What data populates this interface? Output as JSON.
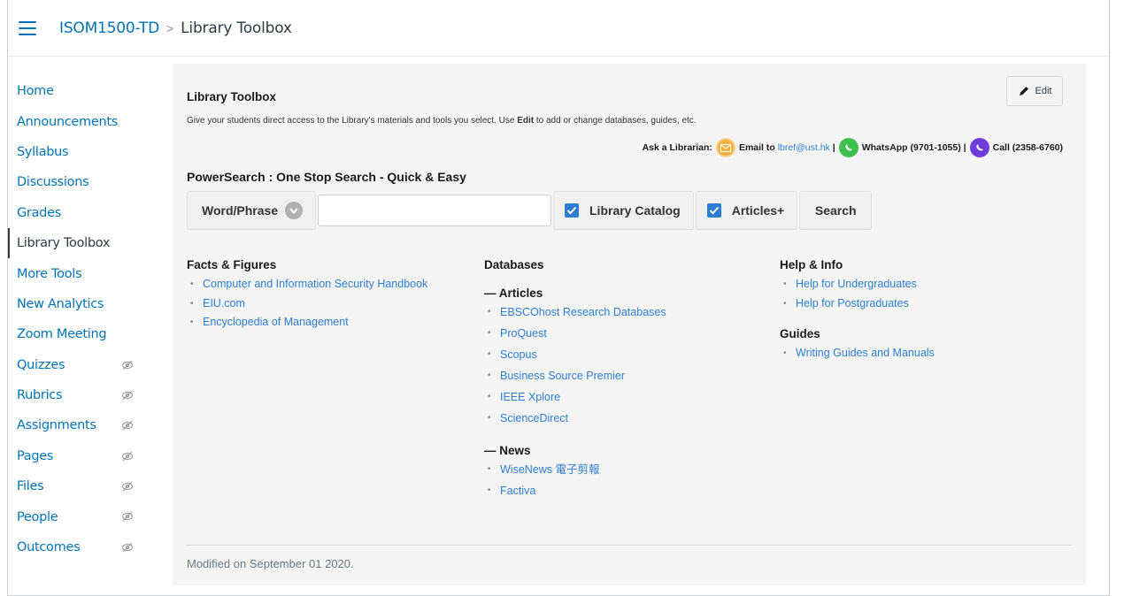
{
  "breadcrumb": {
    "course": "ISOM1500-TD",
    "separator": ">",
    "current": "Library Toolbox"
  },
  "sidebar": {
    "items": [
      {
        "label": "Home",
        "hidden": false,
        "active": false
      },
      {
        "label": "Announcements",
        "hidden": false,
        "active": false
      },
      {
        "label": "Syllabus",
        "hidden": false,
        "active": false
      },
      {
        "label": "Discussions",
        "hidden": false,
        "active": false
      },
      {
        "label": "Grades",
        "hidden": false,
        "active": false
      },
      {
        "label": "Library Toolbox",
        "hidden": false,
        "active": true
      },
      {
        "label": "More Tools",
        "hidden": false,
        "active": false
      },
      {
        "label": "New Analytics",
        "hidden": false,
        "active": false
      },
      {
        "label": "Zoom Meeting",
        "hidden": false,
        "active": false
      },
      {
        "label": "Quizzes",
        "hidden": true,
        "active": false
      },
      {
        "label": "Rubrics",
        "hidden": true,
        "active": false
      },
      {
        "label": "Assignments",
        "hidden": true,
        "active": false
      },
      {
        "label": "Pages",
        "hidden": true,
        "active": false
      },
      {
        "label": "Files",
        "hidden": true,
        "active": false
      },
      {
        "label": "People",
        "hidden": true,
        "active": false
      },
      {
        "label": "Outcomes",
        "hidden": true,
        "active": false
      }
    ]
  },
  "main": {
    "edit_label": "Edit",
    "title": "Library Toolbox",
    "description_before": "Give your students direct access to the Library's materials and tools you select. Use ",
    "description_bold": "Edit",
    "description_after": " to add or change databases, guides, etc.",
    "ask": {
      "label": "Ask a Librarian:",
      "email_prefix": "Email to",
      "email": "lbref@ust.hk",
      "sep1": "|",
      "whatsapp": "WhatsApp (9701-1055)",
      "sep2": "|",
      "call": "Call (2358-6760)"
    },
    "powersearch": {
      "title": "PowerSearch : One Stop Search - Quick & Easy",
      "mode": "Word/Phrase",
      "query_value": "",
      "opt_catalog": "Library Catalog",
      "opt_articles": "Articles+",
      "search_label": "Search"
    },
    "facts": {
      "heading": "Facts & Figures",
      "links": [
        "Computer and Information Security Handbook",
        "EIU.com",
        "Encyclopedia of Management"
      ]
    },
    "databases": {
      "heading": "Databases",
      "articles_heading": "— Articles",
      "articles": [
        "EBSCOhost Research Databases",
        "ProQuest",
        "Scopus",
        "Business Source Premier",
        "IEEE Xplore",
        "ScienceDirect"
      ],
      "news_heading": "— News",
      "news": [
        "WiseNews 電子剪報",
        "Factiva"
      ]
    },
    "help": {
      "heading": "Help & Info",
      "links": [
        "Help for Undergraduates",
        "Help for Postgraduates"
      ],
      "guides_heading": "Guides",
      "guides": [
        "Writing Guides and Manuals"
      ]
    },
    "modified": "Modified on September 01 2020."
  },
  "colors": {
    "link": "#0374b5",
    "accent": "#2d7dd2"
  }
}
